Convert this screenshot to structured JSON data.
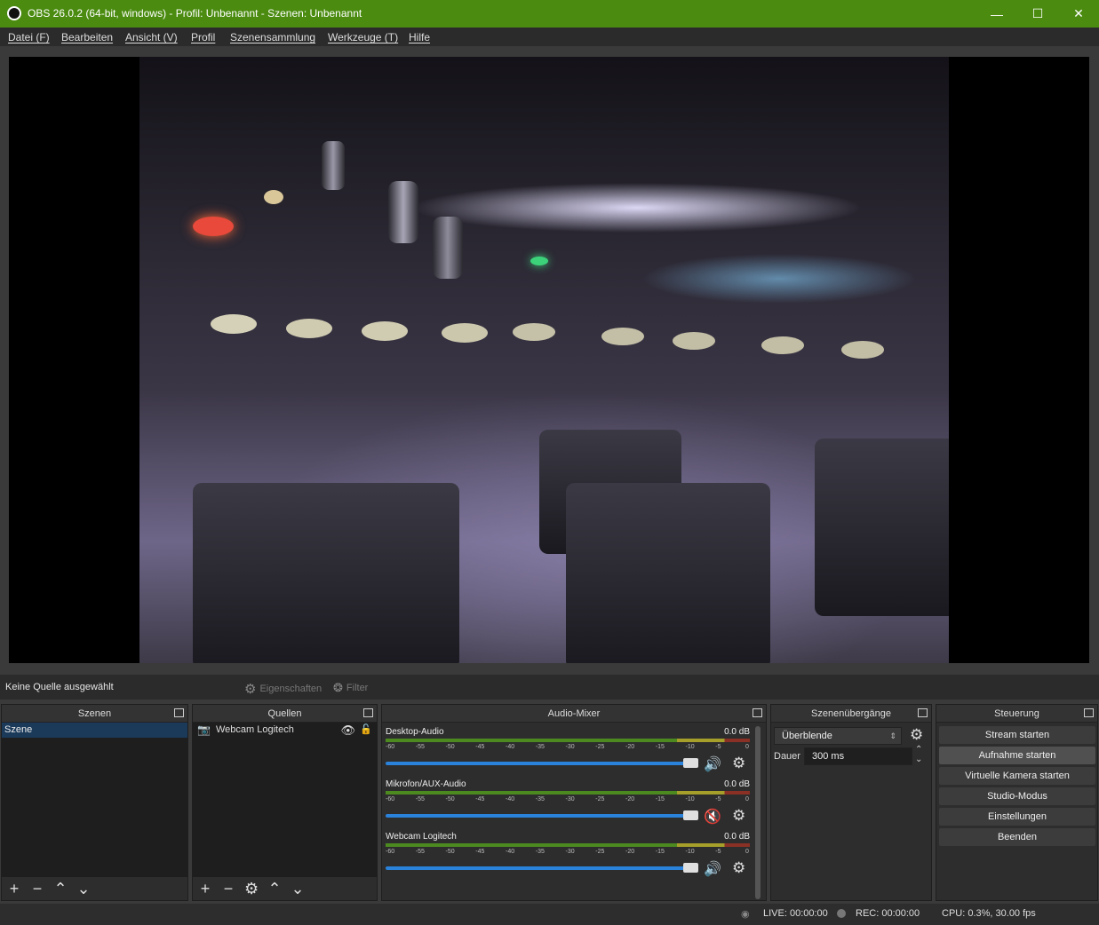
{
  "window": {
    "title": "OBS 26.0.2 (64-bit, windows) - Profil: Unbenannt - Szenen: Unbenannt",
    "minimize": "—",
    "maximize": "☐",
    "close": "✕"
  },
  "menu": [
    "Datei (F)",
    "Bearbeiten",
    "Ansicht (V)",
    "Profil",
    "Szenensammlung",
    "Werkzeuge (T)",
    "Hilfe"
  ],
  "status": {
    "no_source": "Keine Quelle ausgewählt",
    "properties": "Eigenschaften",
    "filter": "Filter"
  },
  "scenes": {
    "title": "Szenen",
    "items": [
      "Szene"
    ]
  },
  "sources": {
    "title": "Quellen",
    "items": [
      "Webcam Logitech"
    ]
  },
  "mixer": {
    "title": "Audio-Mixer",
    "ticks": [
      "-60",
      "-55",
      "-50",
      "-45",
      "-40",
      "-35",
      "-30",
      "-25",
      "-20",
      "-15",
      "-10",
      "-5",
      "0"
    ],
    "channels": [
      {
        "name": "Desktop-Audio",
        "db": "0.0 dB",
        "muted": false,
        "volume": 1.0
      },
      {
        "name": "Mikrofon/AUX-Audio",
        "db": "0.0 dB",
        "muted": true,
        "volume": 1.0
      },
      {
        "name": "Webcam Logitech",
        "db": "0.0 dB",
        "muted": false,
        "volume": 1.0
      }
    ]
  },
  "transitions": {
    "title": "Szenenübergänge",
    "selected": "Überblende",
    "duration_label": "Dauer",
    "duration": "300 ms"
  },
  "controls": {
    "title": "Steuerung",
    "buttons": [
      "Stream starten",
      "Aufnahme starten",
      "Virtuelle Kamera starten",
      "Studio-Modus",
      "Einstellungen",
      "Beenden"
    ]
  },
  "statusbar": {
    "live": "LIVE: 00:00:00",
    "rec": "REC: 00:00:00",
    "cpu": "CPU: 0.3%, 30.00 fps"
  },
  "colors": {
    "titlebar": "#4a8b10",
    "accent": "#2a82da",
    "muted": "#d21a1a"
  }
}
